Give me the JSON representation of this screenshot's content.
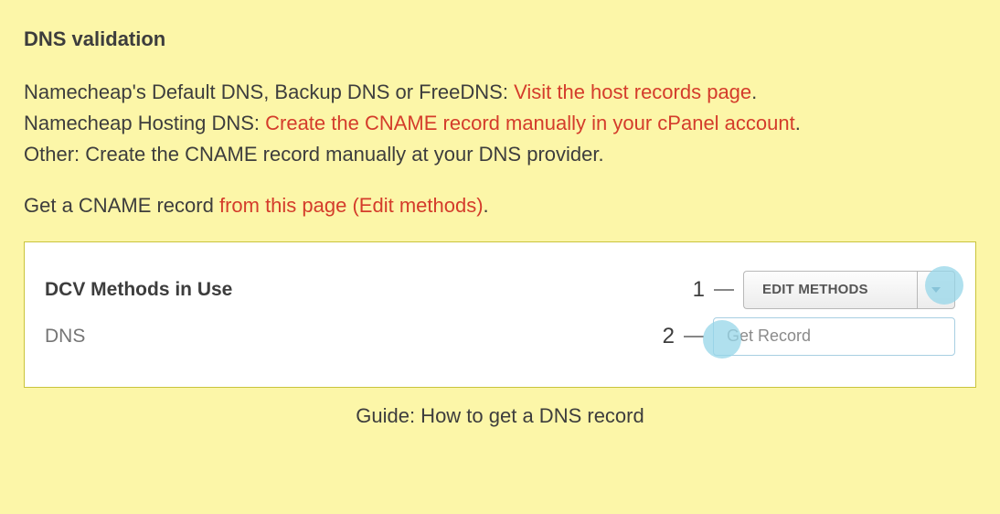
{
  "heading": "DNS validation",
  "lines": {
    "prefix1": "Namecheap's Default DNS, Backup DNS or FreeDNS: ",
    "link1": "Visit the host records page",
    "suffix1": ".",
    "prefix2": "Namecheap Hosting DNS: ",
    "link2": "Create the CNAME record manually in your cPanel account",
    "suffix2": ".",
    "line3": "Other: Create the CNAME record manually at your DNS provider."
  },
  "cname": {
    "prefix": "Get a CNAME record ",
    "link": "from this page (Edit methods)",
    "suffix": "."
  },
  "panel": {
    "title": "DCV Methods in Use",
    "method": "DNS",
    "step1": "1",
    "step2": "2",
    "edit_label": "EDIT METHODS",
    "dropdown_item": "Get Record"
  },
  "caption": "Guide: How to get a DNS record"
}
